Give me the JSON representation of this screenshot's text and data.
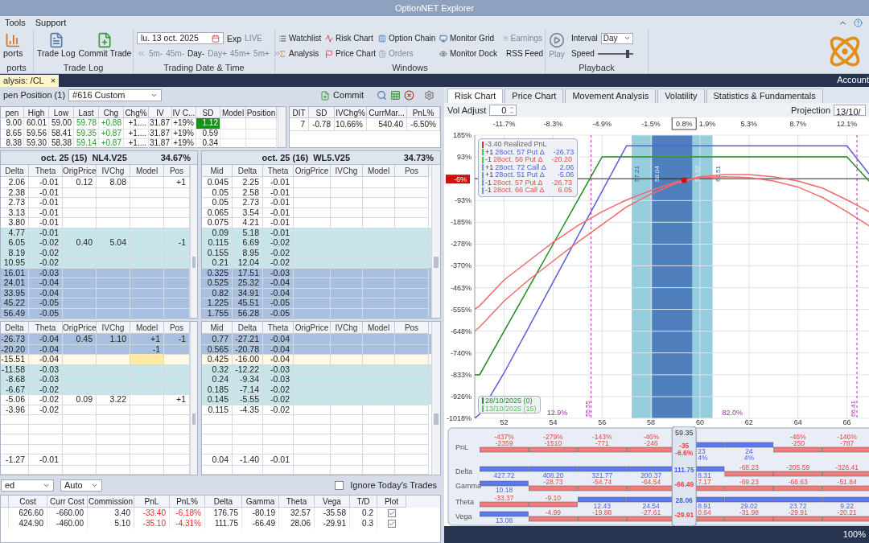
{
  "window": {
    "title": "OptionNET Explorer"
  },
  "menu": [
    "Tools",
    "Support"
  ],
  "ribbon": {
    "groups": [
      {
        "kind": "reports",
        "label": "ports",
        "buttons": [
          {
            "label": "ports"
          }
        ]
      },
      {
        "kind": "tradelog",
        "label": "Trade Log",
        "buttons": [
          {
            "label": "Trade Log"
          },
          {
            "label": "Commit Trade"
          }
        ]
      },
      {
        "kind": "datetime",
        "label": "Trading Date & Time",
        "date": "lu. 13 oct. 2025",
        "exp": "Exp",
        "live": {
          "label": "LIVE",
          "disabled": true
        },
        "steps": [
          {
            "label": "5m-",
            "disabled": true
          },
          {
            "label": "45m-",
            "disabled": true
          },
          {
            "label": "Day-",
            "disabled": false
          },
          {
            "label": "Day+",
            "disabled": true
          },
          {
            "label": "45m+",
            "disabled": true
          },
          {
            "label": "5m+",
            "disabled": true
          }
        ]
      },
      {
        "kind": "windows",
        "label": "Windows",
        "items": [
          {
            "label": "Watchlist",
            "disabled": false
          },
          {
            "label": "Risk Chart",
            "disabled": false
          },
          {
            "label": "Option Chain",
            "disabled": false
          },
          {
            "label": "Monitor Grid",
            "disabled": false
          },
          {
            "label": "Earnings",
            "disabled": true
          },
          {
            "label": "Analysis",
            "disabled": false
          },
          {
            "label": "Price Chart",
            "disabled": false
          },
          {
            "label": "Orders",
            "disabled": true
          },
          {
            "label": "Monitor Dock",
            "disabled": false
          },
          {
            "label": "RSS Feed",
            "disabled": false
          }
        ]
      },
      {
        "kind": "playback",
        "label": "Playback",
        "play": {
          "label": "Play",
          "disabled": true
        },
        "interval_label": "Interval",
        "interval": "Day",
        "speed_label": "Speed",
        "speed": {
          "level": 0.85
        }
      }
    ]
  },
  "doc_tab": {
    "label": "alysis: /CL",
    "close": "×"
  },
  "account": "Account",
  "position_bar": {
    "label": "pen Position (1)",
    "position": "#616 Custom",
    "commit": "Commit"
  },
  "quote": {
    "columns": [
      {
        "label": "pen",
        "kind": "plain"
      },
      {
        "label": "High",
        "kind": "plain"
      },
      {
        "label": "Low",
        "kind": "plain"
      },
      {
        "label": "Last",
        "kind": "up"
      },
      {
        "label": "Chg",
        "kind": "up"
      },
      {
        "label": "Chg%",
        "kind": "plain"
      },
      {
        "label": "IV",
        "kind": "plain"
      },
      {
        "label": "IV C...",
        "kind": "plain"
      },
      {
        "label": "SD",
        "kind": "plain"
      },
      {
        "label": "Model",
        "kind": "plain"
      },
      {
        "label": "Position",
        "kind": "plain"
      }
    ],
    "rows": [
      {
        "cells": [
          "9.00",
          "60.01",
          "59.00",
          "59.78",
          "+0.88",
          "+1....",
          "31.87",
          "+19%",
          "1.12"
        ],
        "sd_highlighted": true
      },
      {
        "cells": [
          "8.65",
          "59.56",
          "58.41",
          "59.35",
          "+0.87",
          "+1....",
          "31.87",
          "+19%",
          "0.59"
        ],
        "sd_highlighted": false
      },
      {
        "cells": [
          "8.38",
          "59.30",
          "58.38",
          "59.14",
          "+0.87",
          "+1....",
          "31.87",
          "+19%",
          "0.34"
        ],
        "sd_highlighted": false
      }
    ]
  },
  "summary": {
    "columns": [
      "DIT",
      "SD",
      "IVChg%",
      "CurrMar...",
      "PnL%"
    ],
    "rows": [
      [
        "7",
        "-0.78",
        "10.66%",
        "540.40",
        "-6.50%"
      ]
    ]
  },
  "chains": [
    {
      "left": {
        "expiry": "oct. 25 (15)",
        "symbol": "NL4.V25",
        "iv": "34.67%",
        "columns": [
          "Delta",
          "Theta",
          "OrigPrice",
          "IVChg",
          "Model",
          "Pos"
        ],
        "rows": [
          {
            "kind": "plain",
            "cells": [
              "2.06",
              "-0.01",
              "0.12",
              "8.08",
              null,
              "+1"
            ]
          },
          {
            "kind": "plain",
            "cells": [
              "2.38",
              "-0.01"
            ]
          },
          {
            "kind": "plain",
            "cells": [
              "2.73",
              "-0.01"
            ]
          },
          {
            "kind": "plain",
            "cells": [
              "3.13",
              "-0.01"
            ]
          },
          {
            "kind": "plain",
            "cells": [
              "3.80",
              "-0.01"
            ]
          },
          {
            "kind": "light",
            "cells": [
              "4.77",
              "-0.01"
            ]
          },
          {
            "kind": "light",
            "cells": [
              "6.05",
              "-0.02",
              "0.40",
              "5.04",
              null,
              "-1"
            ]
          },
          {
            "kind": "light",
            "cells": [
              "8.19",
              "-0.02"
            ]
          },
          {
            "kind": "light",
            "cells": [
              "10.95",
              "-0.02"
            ]
          },
          {
            "kind": "dark",
            "cells": [
              "16.01",
              "-0.03"
            ]
          },
          {
            "kind": "dark",
            "cells": [
              "24.01",
              "-0.04"
            ]
          },
          {
            "kind": "dark",
            "cells": [
              "33.95",
              "-0.04"
            ]
          },
          {
            "kind": "dark",
            "cells": [
              "45.22",
              "-0.05"
            ]
          },
          {
            "kind": "dark",
            "cells": [
              "56.49",
              "-0.05"
            ]
          }
        ]
      },
      "right": {
        "expiry": "oct. 25 (16)",
        "symbol": "WL5.V25",
        "iv": "34.73%",
        "columns": [
          "Mid",
          "Delta",
          "Theta",
          "OrigPrice",
          "IVChg",
          "Model",
          "Pos"
        ],
        "rows": [
          {
            "kind": "plain",
            "cells": [
              "0.045",
              "2.25",
              "-0.01"
            ]
          },
          {
            "kind": "plain",
            "cells": [
              "0.05",
              "2.58",
              "-0.01"
            ]
          },
          {
            "kind": "plain",
            "cells": [
              "0.05",
              "2.73",
              "-0.01"
            ]
          },
          {
            "kind": "plain",
            "cells": [
              "0.065",
              "3.54",
              "-0.01"
            ]
          },
          {
            "kind": "plain",
            "cells": [
              "0.075",
              "4.21",
              "-0.01"
            ]
          },
          {
            "kind": "light",
            "cells": [
              "0.09",
              "5.18",
              "-0.01"
            ]
          },
          {
            "kind": "light",
            "cells": [
              "0.115",
              "6.69",
              "-0.02"
            ]
          },
          {
            "kind": "light",
            "cells": [
              "0.155",
              "8.95",
              "-0.02"
            ]
          },
          {
            "kind": "light",
            "cells": [
              "0.21",
              "12.04",
              "-0.02"
            ]
          },
          {
            "kind": "dark",
            "cells": [
              "0.325",
              "17.51",
              "-0.03"
            ]
          },
          {
            "kind": "dark",
            "cells": [
              "0.525",
              "25.32",
              "-0.04"
            ]
          },
          {
            "kind": "dark",
            "cells": [
              "0.82",
              "34.91",
              "-0.04"
            ]
          },
          {
            "kind": "dark",
            "cells": [
              "1.225",
              "45.51",
              "-0.05"
            ]
          },
          {
            "kind": "dark",
            "cells": [
              "1.755",
              "56.28",
              "-0.05"
            ]
          }
        ]
      }
    },
    {
      "left": {
        "columns": [
          "Delta",
          "Theta",
          "OrigPrice",
          "IVChg",
          "Model",
          "Pos"
        ],
        "rows": [
          {
            "kind": "dark",
            "cells": [
              "-26.73",
              "-0.04",
              "0.45",
              "1.10",
              "+1",
              "-1"
            ]
          },
          {
            "kind": "dark",
            "cells": [
              "-20.20",
              "-0.04",
              null,
              null,
              "-1"
            ]
          },
          {
            "kind": "edit",
            "cells": [
              "-15.51",
              "-0.04"
            ]
          },
          {
            "kind": "light",
            "cells": [
              "-11.58",
              "-0.03"
            ]
          },
          {
            "kind": "light",
            "cells": [
              "-8.68",
              "-0.03"
            ]
          },
          {
            "kind": "light",
            "cells": [
              "-6.67",
              "-0.02"
            ]
          },
          {
            "kind": "plain",
            "cells": [
              "-5.06",
              "-0.02",
              "0.09",
              "3.22",
              null,
              "+1"
            ]
          },
          {
            "kind": "plain",
            "cells": [
              "-3.96",
              "-0.02"
            ]
          },
          {
            "kind": "plain"
          },
          {
            "kind": "plain"
          },
          {
            "kind": "plain"
          },
          {
            "kind": "plain"
          },
          {
            "kind": "plain",
            "cells": [
              "-1.27",
              "-0.01"
            ]
          },
          {
            "kind": "plain"
          }
        ]
      },
      "right": {
        "columns": [
          "Mid",
          "Delta",
          "Theta",
          "OrigPrice",
          "IVChg",
          "Model",
          "Pos"
        ],
        "rows": [
          {
            "kind": "dark",
            "cells": [
              "0.77",
              "-27.21",
              "-0.04"
            ]
          },
          {
            "kind": "dark",
            "cells": [
              "0.565",
              "-20.78",
              "-0.04"
            ]
          },
          {
            "kind": "edit",
            "cells": [
              "0.425",
              "-16.00",
              "-0.04"
            ]
          },
          {
            "kind": "light",
            "cells": [
              "0.32",
              "-12.22",
              "-0.03"
            ]
          },
          {
            "kind": "light",
            "cells": [
              "0.24",
              "-9.34",
              "-0.03"
            ]
          },
          {
            "kind": "light",
            "cells": [
              "0.185",
              "-7.14",
              "-0.02"
            ]
          },
          {
            "kind": "light",
            "cells": [
              "0.145",
              "-5.55",
              "-0.02"
            ]
          },
          {
            "kind": "plain",
            "cells": [
              "0.115",
              "-4.35",
              "-0.02"
            ]
          },
          {
            "kind": "plain"
          },
          {
            "kind": "plain"
          },
          {
            "kind": "plain"
          },
          {
            "kind": "plain"
          },
          {
            "kind": "plain",
            "cells": [
              "0.04",
              "-1.40",
              "-0.01"
            ]
          },
          {
            "kind": "plain"
          }
        ]
      }
    }
  ],
  "filters": {
    "filter": "ed",
    "mode": "Auto",
    "ignore_today": {
      "label": "Ignore Today's Trades",
      "checked": false
    }
  },
  "positions": {
    "columns": [
      {
        "label": "Cost",
        "kind": "plain"
      },
      {
        "label": "Curr Cost",
        "kind": "plain"
      },
      {
        "label": "Commission",
        "kind": "plain"
      },
      {
        "label": "PnL",
        "kind": "loss"
      },
      {
        "label": "PnL%",
        "kind": "loss"
      },
      {
        "label": "Delta",
        "kind": "plain"
      },
      {
        "label": "Gamma",
        "kind": "plain"
      },
      {
        "label": "Theta",
        "kind": "plain"
      },
      {
        "label": "Vega",
        "kind": "plain"
      },
      {
        "label": "T/D",
        "kind": "plain"
      },
      {
        "label": "Plot",
        "kind": "check"
      }
    ],
    "rows": [
      {
        "cells": [
          "626.60",
          "-660.00",
          "3.40",
          "-33.40",
          "-6.18%",
          "176.75",
          "-80.19",
          "32.57",
          "-35.58",
          "0.2"
        ],
        "plot": true
      },
      {
        "cells": [
          "424.90",
          "-460.00",
          "5.10",
          "-35.10",
          "-4.31%",
          "111.75",
          "-66.49",
          "28.06",
          "-29.91",
          "0.3"
        ],
        "plot": true
      }
    ]
  },
  "right_panel": {
    "tabs": [
      {
        "label": "Risk Chart",
        "selected": true
      },
      {
        "label": "Price Chart",
        "selected": false
      },
      {
        "label": "Movement Analysis",
        "selected": false
      },
      {
        "label": "Volatility",
        "selected": false
      },
      {
        "label": "Statistics & Fundamentals",
        "selected": false
      }
    ],
    "vol_adjust": {
      "label": "Vol Adjust",
      "value": "0"
    },
    "projection": {
      "label": "Projection",
      "value": "13/10/"
    },
    "chart_data": {
      "type": "line",
      "grid": true,
      "x": [
        50.8,
        51,
        52,
        53,
        54,
        55,
        56,
        57,
        58,
        59,
        60,
        61,
        62,
        63,
        64,
        65,
        66,
        66.9
      ],
      "series": [
        {
          "color": "#1e8c1e",
          "values": [
            -833,
            -833,
            -648,
            -463,
            -278,
            -93,
            93,
            93,
            93,
            93,
            93,
            93,
            93,
            93,
            93,
            93,
            93,
            -10
          ]
        },
        {
          "color": "#5c5ce0",
          "values": [
            -1018,
            -1000,
            -825,
            -632,
            -439,
            -246,
            -53,
            140,
            140,
            140,
            140,
            140,
            140,
            140,
            140,
            140,
            140,
            20
          ]
        },
        {
          "color": "#f26b6b",
          "values": [
            -555,
            -540,
            -430,
            -350,
            -270,
            -200,
            -140,
            -90,
            -50,
            -15,
            8,
            18,
            18,
            8,
            -10,
            -40,
            -90,
            -140
          ]
        },
        {
          "color": "#f26b6b",
          "values": [
            -648,
            -630,
            -520,
            -430,
            -350,
            -270,
            -195,
            -120,
            -65,
            -20,
            5,
            8,
            5,
            -10,
            -35,
            -80,
            -140,
            -200
          ]
        }
      ],
      "ylim": [
        -1018,
        185
      ],
      "bands": [
        {
          "axis": "x",
          "from": 57.21,
          "to": 60.51,
          "color": "#95cddc"
        },
        {
          "axis": "x",
          "from": 58.04,
          "to": 59.68,
          "color": "#4f80bd"
        }
      ],
      "ref_lines": [
        {
          "axis": "x",
          "value": 55.55,
          "label": "55.55",
          "color": "#b030b0"
        },
        {
          "axis": "x",
          "value": 66.41,
          "label": "66.41",
          "color": "#b030b0"
        }
      ],
      "xticks": [
        52,
        54,
        56,
        58,
        60,
        62,
        64,
        66
      ],
      "yticks": [
        {
          "value": 185,
          "label": "185%"
        },
        {
          "value": 93,
          "label": "93%"
        },
        {
          "value": -93,
          "label": "-93%"
        },
        {
          "value": -185,
          "label": "-185%"
        },
        {
          "value": -278,
          "label": "-278%"
        },
        {
          "value": -370,
          "label": "-370%"
        },
        {
          "value": -463,
          "label": "-463%"
        },
        {
          "value": -555,
          "label": "-555%"
        },
        {
          "value": -648,
          "label": "-648%"
        },
        {
          "value": -740,
          "label": "-740%"
        },
        {
          "value": -833,
          "label": "-833%"
        },
        {
          "value": -926,
          "label": "-926%"
        },
        {
          "value": -1018,
          "label": "-1018%"
        }
      ],
      "xlim": [
        50.8,
        66.9
      ]
    },
    "chart_overlays": {
      "band_labels": [
        "57.21",
        "58.04",
        "59.68",
        "60.51"
      ],
      "probabilities": [
        "12.9%",
        "82.0%"
      ],
      "pnl_marker": "-6%",
      "top_labels": [
        {
          "text": "-11.7%",
          "selected": false
        },
        {
          "text": "-8.3%",
          "selected": false
        },
        {
          "text": "-4.9%",
          "selected": false
        },
        {
          "text": "-1.5%",
          "selected": false
        },
        {
          "text": "0.8%",
          "selected": true
        },
        {
          "text": "1.9%",
          "selected": false
        },
        {
          "text": "5.3%",
          "selected": false
        },
        {
          "text": "8.7%",
          "selected": false
        },
        {
          "text": "12.1%",
          "selected": false
        }
      ]
    },
    "legend": [
      {
        "kind": "realized",
        "color": "#e03030",
        "text": "-3.40 Realized PnL"
      },
      {
        "kind": "long",
        "color": "#40d040",
        "qty": "+1",
        "text": "28oct. 57 Put Δ",
        "value": "-26.73"
      },
      {
        "kind": "short",
        "color": "#40d040",
        "qty": "-1",
        "text": "28oct. 56 Put Δ",
        "value": "-20.20"
      },
      {
        "kind": "long",
        "color": "#7090f0",
        "qty": "+1",
        "text": "28oct. 72 Call Δ",
        "value": "2.06"
      },
      {
        "kind": "long",
        "color": "#7090f0",
        "qty": "+1",
        "text": "28oct. 51 Put Δ",
        "value": "-5.06"
      },
      {
        "kind": "short",
        "color": "#7090f0",
        "qty": "-1",
        "text": "28oct. 57 Put Δ",
        "value": "-26.73"
      },
      {
        "kind": "short",
        "color": "#7090f0",
        "qty": "-1",
        "text": "28oct. 66 Call Δ",
        "value": "6.05"
      }
    ],
    "date_legend": [
      {
        "label": "28/10/2025 (0)",
        "color": "#2e8b2e"
      },
      {
        "label": "13/10/2025 (15)",
        "color": "#62c062"
      }
    ],
    "greeks": {
      "current": "59.35",
      "rows": [
        {
          "label": "PnL",
          "cells": [
            {
              "texts": [
                "-437%",
                "-2359"
              ],
              "negative": true
            },
            {
              "texts": [
                "-279%",
                "-1510"
              ],
              "negative": true
            },
            {
              "texts": [
                "-143%",
                "-771"
              ],
              "negative": true
            },
            {
              "texts": [
                "-46%",
                "-246"
              ],
              "negative": true
            },
            {
              "texts": [
                "-35",
                "-6.6%"
              ],
              "negative": true
            },
            {
              "texts": [
                "23",
                "4%"
              ],
              "negative": false
            },
            {
              "texts": [
                "24",
                "4%"
              ],
              "negative": false
            },
            {
              "texts": [
                "-46%",
                "-250"
              ],
              "negative": true
            },
            {
              "texts": [
                "-146%",
                "-787"
              ],
              "negative": true
            }
          ]
        },
        {
          "label": "Delta",
          "cells": [
            {
              "texts": [
                "427.72"
              ],
              "negative": false
            },
            {
              "texts": [
                "408.20"
              ],
              "negative": false
            },
            {
              "texts": [
                "321.77"
              ],
              "negative": false
            },
            {
              "texts": [
                "200.37"
              ],
              "negative": false
            },
            {
              "texts": [
                "111.75"
              ],
              "negative": false
            },
            {
              "texts": [
                "8.31"
              ],
              "negative": false
            },
            {
              "texts": [
                "-68.23"
              ],
              "negative": true
            },
            {
              "texts": [
                "-205.59"
              ],
              "negative": true
            },
            {
              "texts": [
                "-326.41"
              ],
              "negative": true
            }
          ]
        },
        {
          "label": "Gamma",
          "cells": [
            {
              "texts": [
                "10.18"
              ],
              "negative": false
            },
            {
              "texts": [
                "-28.73"
              ],
              "negative": true
            },
            {
              "texts": [
                "-54.74"
              ],
              "negative": true
            },
            {
              "texts": [
                "-64.54"
              ],
              "negative": true
            },
            {
              "texts": [
                "-66.49"
              ],
              "negative": true
            },
            {
              "texts": [
                "7.17"
              ],
              "negative": true
            },
            {
              "texts": [
                "-69.23"
              ],
              "negative": true
            },
            {
              "texts": [
                "-66.63"
              ],
              "negative": true
            },
            {
              "texts": [
                "-51.84"
              ],
              "negative": true
            }
          ]
        },
        {
          "label": "Theta",
          "cells": [
            {
              "texts": [
                "-33.37"
              ],
              "negative": true
            },
            {
              "texts": [
                "-9.10"
              ],
              "negative": true
            },
            {
              "texts": [
                "12.43"
              ],
              "negative": false
            },
            {
              "texts": [
                "24.54"
              ],
              "negative": false
            },
            {
              "texts": [
                "28.06"
              ],
              "negative": false
            },
            {
              "texts": [
                "8.91"
              ],
              "negative": false
            },
            {
              "texts": [
                "29.02"
              ],
              "negative": false
            },
            {
              "texts": [
                "23.72"
              ],
              "negative": false
            },
            {
              "texts": [
                "9.22"
              ],
              "negative": false
            }
          ]
        },
        {
          "label": "Vega",
          "cells": [
            {
              "texts": [
                "13.08"
              ],
              "negative": false
            },
            {
              "texts": [
                "-4.99"
              ],
              "negative": true
            },
            {
              "texts": [
                "-19.88"
              ],
              "negative": true
            },
            {
              "texts": [
                "-27.61"
              ],
              "negative": true
            },
            {
              "texts": [
                "-29.91"
              ],
              "negative": true
            },
            {
              "texts": [
                "0.64"
              ],
              "negative": true
            },
            {
              "texts": [
                "-31.98"
              ],
              "negative": true
            },
            {
              "texts": [
                "-29.91"
              ],
              "negative": true
            },
            {
              "texts": [
                "-20.21"
              ],
              "negative": true
            }
          ]
        }
      ]
    },
    "status": "100%"
  }
}
